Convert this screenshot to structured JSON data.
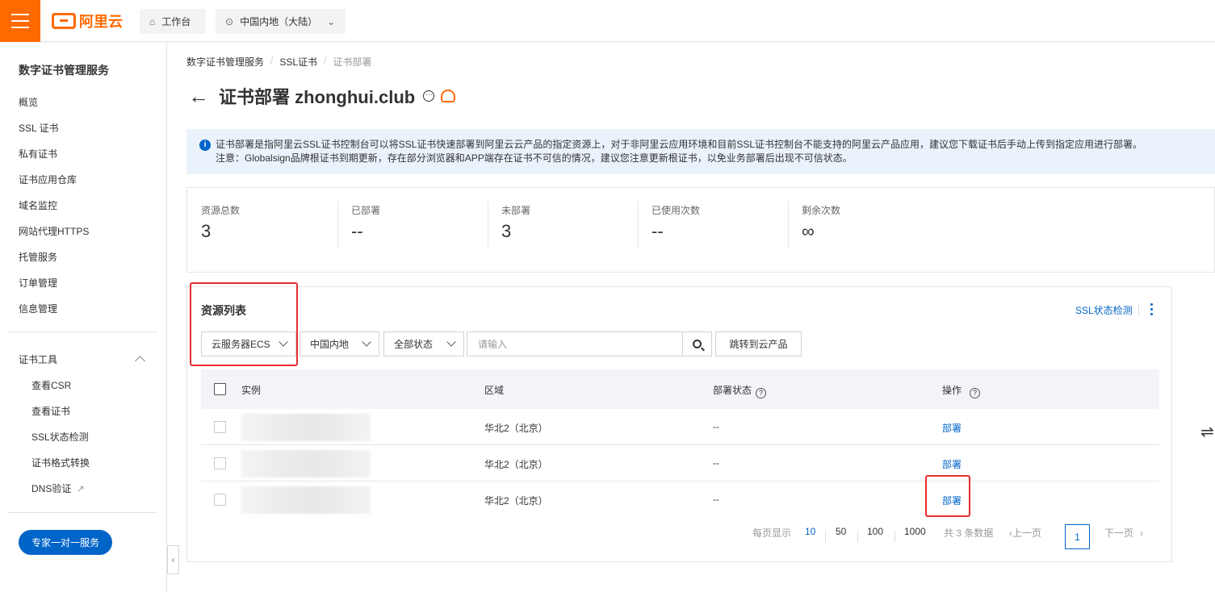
{
  "topbar": {
    "logo_text": "阿里云",
    "workbench_label": "工作台",
    "region_label": "中国内地（大陆）"
  },
  "sidebar": {
    "title": "数字证书管理服务",
    "items": [
      {
        "label": "概览"
      },
      {
        "label": "SSL 证书"
      },
      {
        "label": "私有证书"
      },
      {
        "label": "证书应用仓库"
      },
      {
        "label": "域名监控"
      },
      {
        "label": "网站代理HTTPS"
      },
      {
        "label": "托管服务"
      },
      {
        "label": "订单管理"
      },
      {
        "label": "信息管理"
      }
    ],
    "tools_group": "证书工具",
    "tools": [
      {
        "label": "查看CSR"
      },
      {
        "label": "查看证书"
      },
      {
        "label": "SSL状态检测"
      },
      {
        "label": "证书格式转换"
      },
      {
        "label": "DNS验证"
      }
    ],
    "expert_button": "专家一对一服务"
  },
  "breadcrumb": [
    "数字证书管理服务",
    "SSL证书",
    "证书部署"
  ],
  "page": {
    "title": "证书部署 zhonghui.club"
  },
  "notice": {
    "line1": "证书部署是指阿里云SSL证书控制台可以将SSL证书快速部署到阿里云云产品的指定资源上，对于非阿里云应用环境和目前SSL证书控制台不能支持的阿里云产品应用，建议您下载证书后手动上传到指定应用进行部署。",
    "line2": "注意：Globalsign品牌根证书到期更新，存在部分浏览器和APP端存在证书不可信的情况，建议您注意更新根证书，以免业务部署后出现不可信状态。"
  },
  "stats": [
    {
      "label": "资源总数",
      "value": "3"
    },
    {
      "label": "已部署",
      "value": "--"
    },
    {
      "label": "未部署",
      "value": "3"
    },
    {
      "label": "已使用次数",
      "value": "--"
    },
    {
      "label": "剩余次数",
      "value": "∞"
    }
  ],
  "resources": {
    "title": "资源列表",
    "ssl_check_link": "SSL状态检测",
    "filters": {
      "product": "云服务器ECS",
      "region": "中国内地",
      "status": "全部状态",
      "search_placeholder": "请输入",
      "goto_button": "跳转到云产品"
    },
    "columns": [
      "实例",
      "区域",
      "部署状态",
      "操作"
    ],
    "rows": [
      {
        "instance": "",
        "region": "华北2（北京）",
        "status": "--",
        "action": "部署"
      },
      {
        "instance": "",
        "region": "华北2（北京）",
        "status": "--",
        "action": "部署"
      },
      {
        "instance": "",
        "region": "华北2（北京）",
        "status": "--",
        "action": "部署"
      }
    ]
  },
  "pagination": {
    "per_page_label": "每页显示",
    "sizes": [
      "10",
      "50",
      "100",
      "1000"
    ],
    "selected_size": "10",
    "total_text": "共 3 条数据",
    "prev_label": "上一页",
    "next_label": "下一页",
    "current_page": "1"
  },
  "colors": {
    "brand": "#ff6a00",
    "link": "#0064c8",
    "highlight": "#e52e2e"
  }
}
